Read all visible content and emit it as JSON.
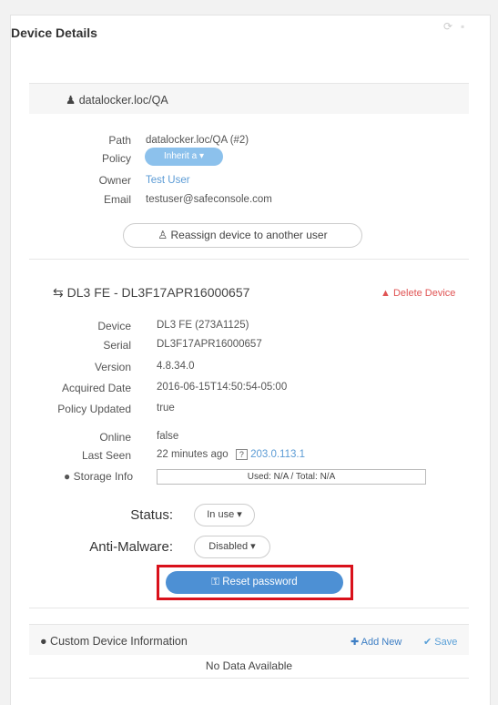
{
  "panel": {
    "title": "Device Details"
  },
  "owner_section": {
    "header": "datalocker.loc/QA",
    "fields": [
      {
        "label": "Path",
        "value": "datalocker.loc/QA (#2)"
      },
      {
        "label": "Policy",
        "value": "Inherit a"
      },
      {
        "label": "Owner",
        "value": "Test User"
      },
      {
        "label": "Email",
        "value": "testuser@safeconsole.com"
      }
    ],
    "reassign_label": "Reassign device to another user"
  },
  "device_section": {
    "header": "DL3 FE - DL3F17APR16000657",
    "delete_label": "Delete Device",
    "fields": [
      {
        "label": "Device",
        "value": "DL3 FE (273A1125)"
      },
      {
        "label": "Serial",
        "value": "DL3F17APR16000657"
      },
      {
        "label": "Version",
        "value": "4.8.34.0"
      },
      {
        "label": "Acquired Date",
        "value": "2016-06-15T14:50:54-05:00"
      },
      {
        "label": "Policy Updated",
        "value": "true"
      },
      {
        "label": "Online",
        "value": "false"
      },
      {
        "label": "Last Seen",
        "value": "22 minutes ago"
      }
    ],
    "last_seen_badge": "?",
    "last_seen_ip": "203.0.113.1",
    "storage_label": "Storage Info",
    "storage_value": "Used: N/A / Total: N/A",
    "status_label": "Status:",
    "status_value": "In use",
    "antimalware_label": "Anti-Malware:",
    "antimalware_value": "Disabled",
    "reset_label": "Reset password"
  },
  "custom_section": {
    "header": "Custom Device Information",
    "add_new_label": "Add New",
    "save_label": "Save",
    "empty_text": "No Data Available"
  },
  "colors": {
    "accent": "#4d90d4",
    "danger": "#e05454",
    "highlight_border": "#d9111b"
  }
}
